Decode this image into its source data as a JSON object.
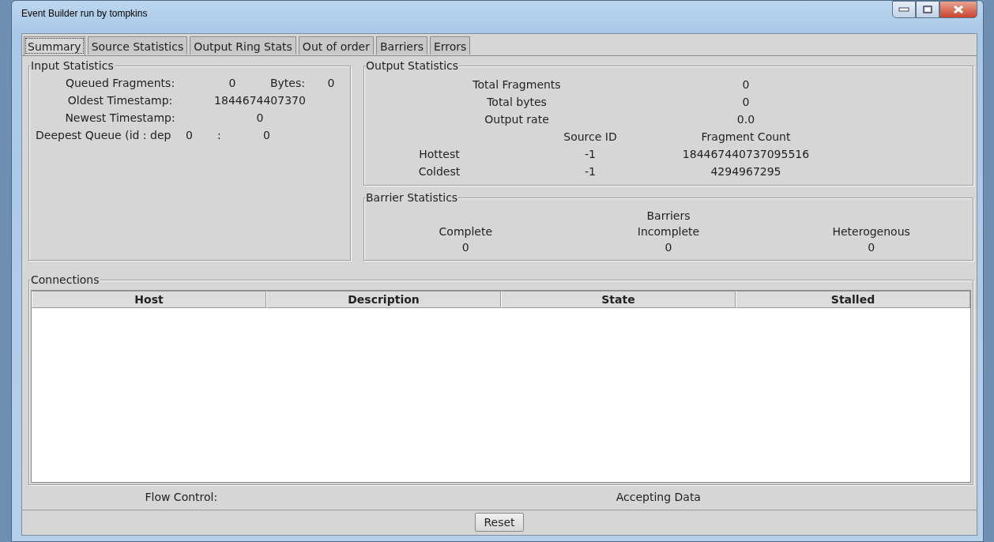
{
  "window": {
    "title": "Event Builder run by tompkins"
  },
  "tabs": [
    {
      "label": "Summary",
      "selected": true
    },
    {
      "label": "Source Statistics",
      "selected": false
    },
    {
      "label": "Output Ring Stats",
      "selected": false
    },
    {
      "label": "Out of order",
      "selected": false
    },
    {
      "label": "Barriers",
      "selected": false
    },
    {
      "label": "Errors",
      "selected": false
    }
  ],
  "input_statistics": {
    "title": "Input Statistics",
    "rows": [
      {
        "kind": "pair",
        "label": "Queued Fragments:",
        "value": "0",
        "bytes_label": "Bytes:",
        "bytes_value": "0"
      },
      {
        "kind": "single",
        "label": "Oldest Timestamp:",
        "value": "1844674407370"
      },
      {
        "kind": "single",
        "label": "Newest Timestamp:",
        "value": "0"
      },
      {
        "kind": "queue",
        "label": "Deepest Queue (id : dep",
        "id": "0",
        "separator": ":",
        "depth": "0"
      }
    ]
  },
  "output_statistics": {
    "title": "Output Statistics",
    "totals": [
      {
        "label": "Total Fragments",
        "value": "0"
      },
      {
        "label": "Total bytes",
        "value": "0"
      },
      {
        "label": "Output rate",
        "value": "0.0"
      }
    ],
    "columns": [
      "Source ID",
      "Fragment Count"
    ],
    "rows": [
      {
        "label": "Hottest",
        "source_id": "-1",
        "fragment_count": "184467440737095516"
      },
      {
        "label": "Coldest",
        "source_id": "-1",
        "fragment_count": "4294967295"
      }
    ]
  },
  "barrier_statistics": {
    "title": "Barrier Statistics",
    "heading": "Barriers",
    "columns": [
      {
        "label": "Complete",
        "value": "0"
      },
      {
        "label": "Incomplete",
        "value": "0"
      },
      {
        "label": "Heterogenous",
        "value": "0"
      }
    ]
  },
  "connections": {
    "title": "Connections",
    "columns": [
      "Host",
      "Description",
      "State",
      "Stalled"
    ]
  },
  "flow_control": {
    "label": "Flow Control:",
    "value": "Accepting Data"
  },
  "buttons": [
    "Reset"
  ]
}
